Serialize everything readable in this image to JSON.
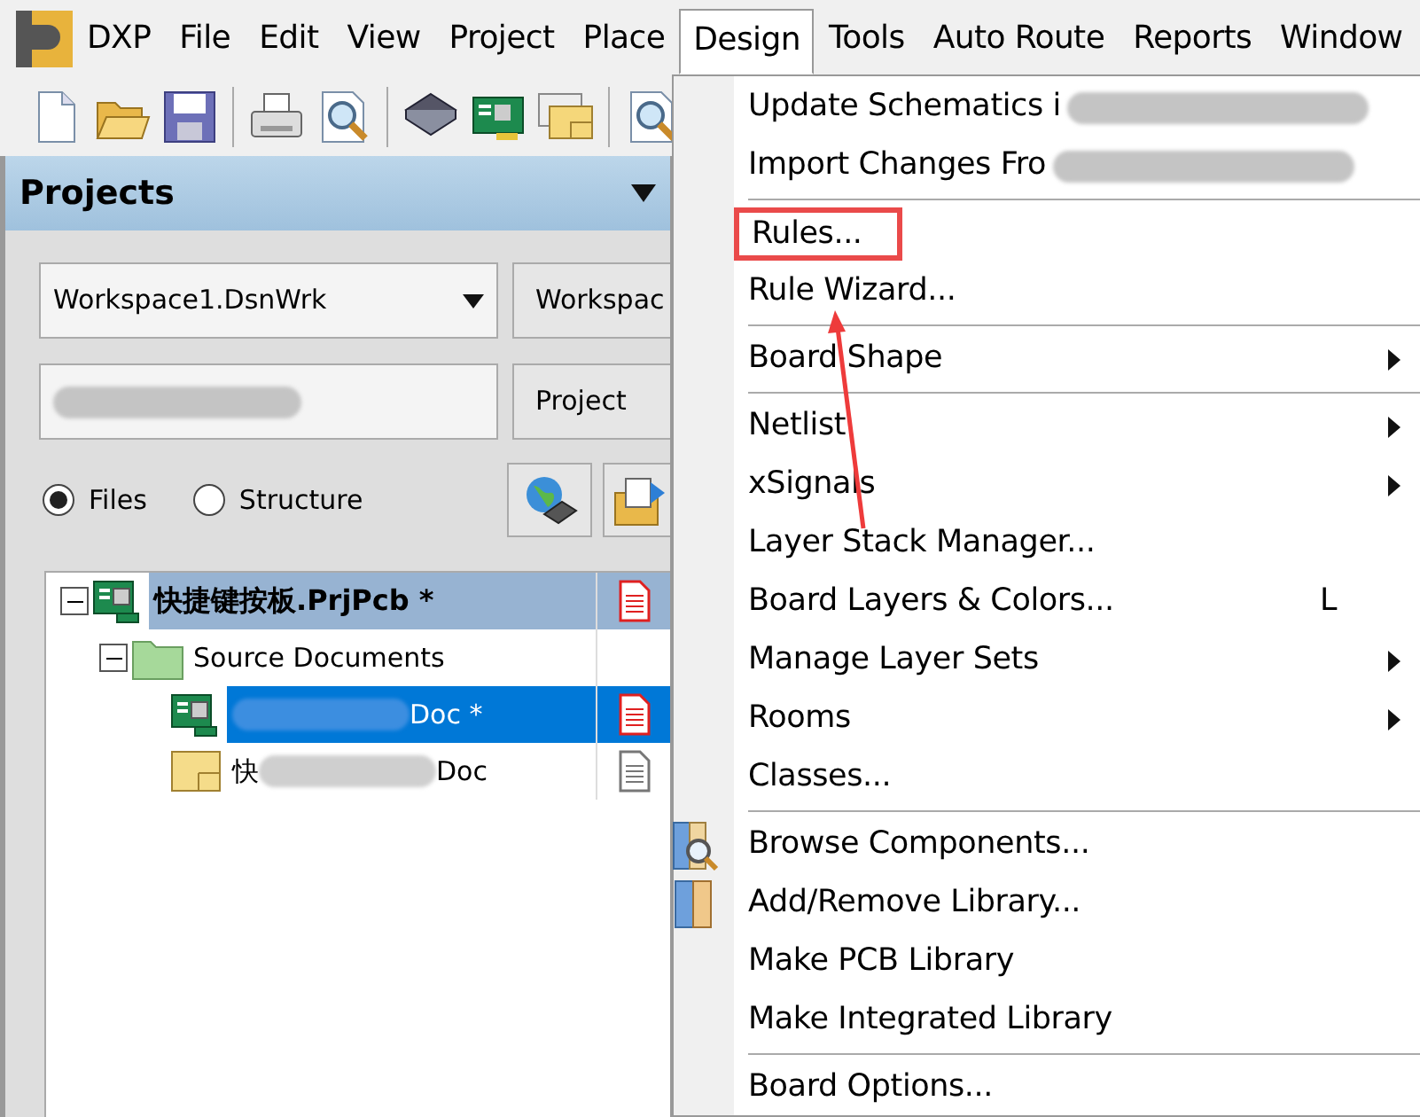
{
  "menubar": [
    {
      "label": "DXP",
      "selected": false
    },
    {
      "label": "File",
      "selected": false
    },
    {
      "label": "Edit",
      "selected": false
    },
    {
      "label": "View",
      "selected": false
    },
    {
      "label": "Project",
      "selected": false
    },
    {
      "label": "Place",
      "selected": false
    },
    {
      "label": "Design",
      "selected": true
    },
    {
      "label": "Tools",
      "selected": false
    },
    {
      "label": "Auto Route",
      "selected": false
    },
    {
      "label": "Reports",
      "selected": false
    },
    {
      "label": "Window",
      "selected": false
    }
  ],
  "toolbar": [
    {
      "kind": "new"
    },
    {
      "kind": "open"
    },
    {
      "kind": "save"
    },
    {
      "kind": "sep"
    },
    {
      "kind": "print"
    },
    {
      "kind": "preview"
    },
    {
      "kind": "sep"
    },
    {
      "kind": "chip"
    },
    {
      "kind": "board"
    },
    {
      "kind": "windows"
    },
    {
      "kind": "sep"
    },
    {
      "kind": "preview"
    }
  ],
  "panel": {
    "title": "Projects",
    "workspace": {
      "value": "Workspace1.DsnWrk",
      "button": "Workspac"
    },
    "project": {
      "button": "Project"
    },
    "view_options": [
      {
        "label": "Files",
        "selected": true
      },
      {
        "label": "Structure",
        "selected": false
      }
    ],
    "tree": [
      {
        "label": "快捷键按板.PrjPcb *",
        "kind": "project",
        "selected": false,
        "expanded": true,
        "modified": true,
        "children": [
          {
            "label": "Source Documents",
            "kind": "folder",
            "selected": false,
            "expanded": true,
            "children": [
              {
                "label": "Doc *",
                "kind": "pcb",
                "selected": true,
                "blurred": true,
                "modified": true
              },
              {
                "label": "快",
                "label_end": "Doc",
                "kind": "schematic",
                "selected": false,
                "blurred": true,
                "modified": false
              }
            ]
          }
        ]
      }
    ]
  },
  "design_menu": [
    {
      "kind": "item",
      "label": "Update Schematics i",
      "submenu": false,
      "blurred": true
    },
    {
      "kind": "item",
      "label": "Import Changes Fro",
      "submenu": false,
      "blurred": true
    },
    {
      "kind": "separator"
    },
    {
      "kind": "item",
      "label": "Rules...",
      "submenu": false,
      "highlighted": true
    },
    {
      "kind": "item",
      "label": "Rule Wizard...",
      "submenu": false
    },
    {
      "kind": "separator"
    },
    {
      "kind": "item",
      "label": "Board Shape",
      "submenu": true
    },
    {
      "kind": "separator"
    },
    {
      "kind": "item",
      "label": "Netlist",
      "submenu": true
    },
    {
      "kind": "item",
      "label": "xSignals",
      "submenu": true
    },
    {
      "kind": "item",
      "label": "Layer Stack Manager...",
      "submenu": false
    },
    {
      "kind": "item",
      "label": "Board Layers & Colors...",
      "submenu": false,
      "shortcut": "L"
    },
    {
      "kind": "item",
      "label": "Manage Layer Sets",
      "submenu": true
    },
    {
      "kind": "item",
      "label": "Rooms",
      "submenu": true
    },
    {
      "kind": "item",
      "label": "Classes...",
      "submenu": false
    },
    {
      "kind": "separator"
    },
    {
      "kind": "icon_item",
      "label": "Browse Components...",
      "submenu": false
    },
    {
      "kind": "icon_item",
      "label": "Add/Remove Library...",
      "submenu": false
    },
    {
      "kind": "item",
      "label": "Make PCB Library",
      "submenu": false
    },
    {
      "kind": "item",
      "label": "Make Integrated Library",
      "submenu": false
    },
    {
      "kind": "separator"
    },
    {
      "kind": "item",
      "label": "Board Options...",
      "submenu": false
    }
  ],
  "annotation": {
    "kind": "arrow"
  }
}
